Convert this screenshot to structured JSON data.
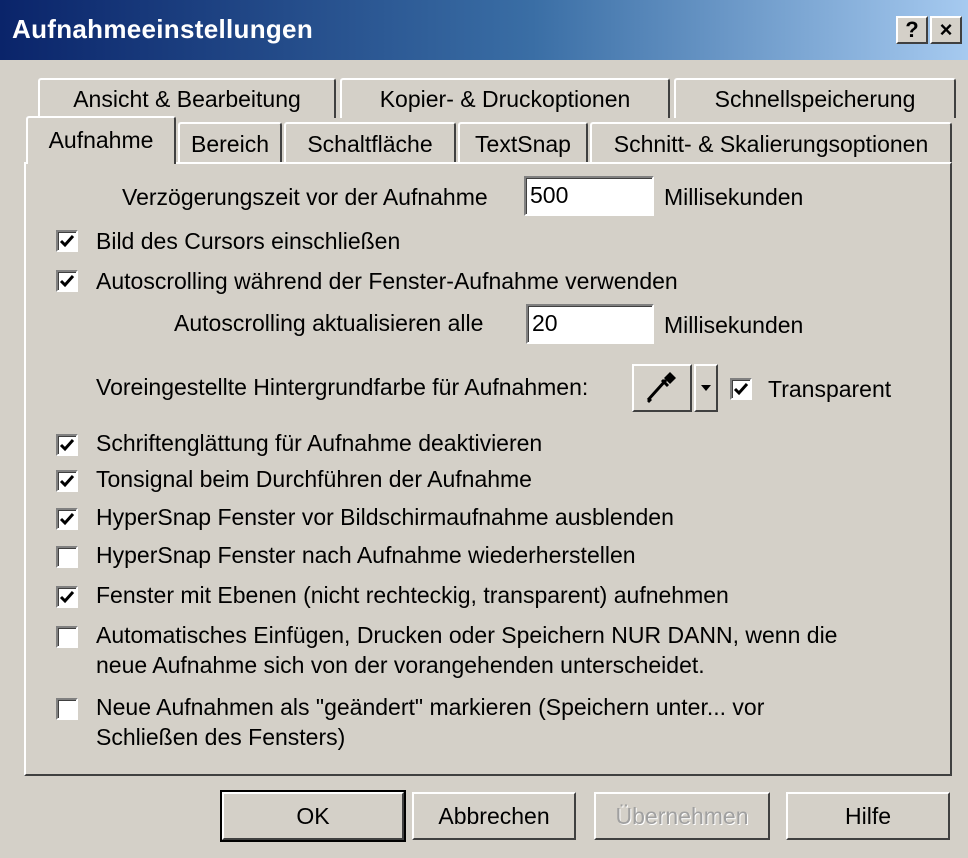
{
  "window": {
    "title": "Aufnahmeeinstellungen",
    "help_button": "?",
    "close_button": "×"
  },
  "tabs": {
    "back_row": [
      "Ansicht & Bearbeitung",
      "Kopier- & Druckoptionen",
      "Schnellspeicherung"
    ],
    "front_row": [
      "Aufnahme",
      "Bereich",
      "Schaltfläche",
      "TextSnap",
      "Schnitt- & Skalierungsoptionen"
    ],
    "active": "Aufnahme"
  },
  "delay": {
    "label": "Verzögerungszeit vor der Aufnahme",
    "value": "500",
    "unit": "Millisekunden"
  },
  "autoscroll_interval": {
    "label": "Autoscrolling aktualisieren alle",
    "value": "20",
    "unit": "Millisekunden"
  },
  "background": {
    "label": "Voreingestellte Hintergrundfarbe für Aufnahmen:",
    "transparent_label": "Transparent",
    "transparent_checked": true,
    "picker_icon": "eyedropper-icon"
  },
  "checkboxes": [
    {
      "label": "Bild des Cursors einschließen",
      "checked": true
    },
    {
      "label": "Autoscrolling während der Fenster-Aufnahme verwenden",
      "checked": true
    },
    {
      "label": "Schriftenglättung für Aufnahme deaktivieren",
      "checked": true
    },
    {
      "label": "Tonsignal beim Durchführen der Aufnahme",
      "checked": true
    },
    {
      "label": "HyperSnap Fenster vor Bildschirmaufnahme ausblenden",
      "checked": true
    },
    {
      "label": "HyperSnap Fenster nach Aufnahme wiederherstellen",
      "checked": false
    },
    {
      "label": "Fenster mit Ebenen (nicht rechteckig, transparent) aufnehmen",
      "checked": true
    },
    {
      "label_line1": "Automatisches Einfügen, Drucken oder Speichern NUR DANN, wenn die",
      "label_line2": "neue Aufnahme sich von der vorangehenden unterscheidet.",
      "checked": false
    },
    {
      "label_line1": "Neue Aufnahmen als \"geändert\" markieren (Speichern unter... vor",
      "label_line2": "Schließen des Fensters)",
      "checked": false
    }
  ],
  "buttons": {
    "ok": "OK",
    "cancel": "Abbrechen",
    "apply": "Übernehmen",
    "help": "Hilfe"
  }
}
